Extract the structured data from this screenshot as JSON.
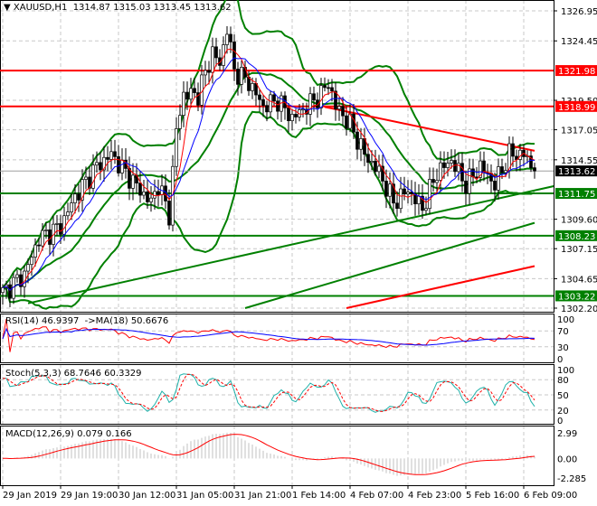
{
  "chart_data": {
    "type": "candlestick",
    "symbol_header": "XAUUSD,H1",
    "ohlc_header": "1314.87 1315.03 1313.45 1313.62",
    "price_axis": {
      "range": [
        1302.2,
        1326.95
      ],
      "ticks": [
        "1326.95",
        "1324.45",
        "1319.50",
        "1317.05",
        "1314.55",
        "1309.60",
        "1307.15",
        "1304.65",
        "1302.20"
      ]
    },
    "current_price": {
      "value": 1313.62,
      "label": "1313.62",
      "color": "#000000"
    },
    "horizontal_levels": [
      {
        "value": 1321.98,
        "label": "1321.98",
        "color": "#ff0000"
      },
      {
        "value": 1318.99,
        "label": "1318.99",
        "color": "#ff0000"
      },
      {
        "value": 1311.75,
        "label": "1311.75",
        "color": "#008000"
      },
      {
        "value": 1308.23,
        "label": "1308.23",
        "color": "#008000"
      },
      {
        "value": 1303.22,
        "label": "1303.22",
        "color": "#008000"
      }
    ],
    "trendlines": [
      {
        "from": [
          89,
          1318.95
        ],
        "to": [
          147,
          1315.3
        ],
        "color": "#ff0000"
      },
      {
        "from": [
          7,
          1302.6
        ],
        "to": [
          153,
          1312.4
        ],
        "color": "#008000"
      },
      {
        "from": [
          67,
          1302.2
        ],
        "to": [
          147,
          1309.3
        ],
        "color": "#008000"
      },
      {
        "from": [
          95,
          1302.2
        ],
        "to": [
          147,
          1305.7
        ],
        "color": "#ff0000"
      }
    ],
    "close_keypoints": [
      [
        0,
        1303.5
      ],
      [
        6,
        1305
      ],
      [
        10,
        1308
      ],
      [
        16,
        1309
      ],
      [
        20,
        1311.5
      ],
      [
        26,
        1314
      ],
      [
        30,
        1315
      ],
      [
        34,
        1313.5
      ],
      [
        38,
        1312
      ],
      [
        41,
        1311
      ],
      [
        43,
        1312.5
      ],
      [
        46,
        1310
      ],
      [
        48,
        1317
      ],
      [
        50,
        1320
      ],
      [
        54,
        1320
      ],
      [
        58,
        1323.5
      ],
      [
        60,
        1322.5
      ],
      [
        62,
        1325.5
      ],
      [
        64,
        1322
      ],
      [
        68,
        1321
      ],
      [
        72,
        1319
      ],
      [
        76,
        1319.5
      ],
      [
        80,
        1318
      ],
      [
        84,
        1319
      ],
      [
        88,
        1320
      ],
      [
        90,
        1321
      ],
      [
        92,
        1319
      ],
      [
        96,
        1317.5
      ],
      [
        100,
        1315
      ],
      [
        104,
        1313.5
      ],
      [
        108,
        1311
      ],
      [
        112,
        1312
      ],
      [
        116,
        1310.5
      ],
      [
        120,
        1313.5
      ],
      [
        124,
        1314.5
      ],
      [
        128,
        1312.5
      ],
      [
        132,
        1314
      ],
      [
        136,
        1312.5
      ],
      [
        140,
        1315
      ],
      [
        144,
        1315
      ],
      [
        147,
        1313.62
      ]
    ],
    "time_axis": [
      "29 Jan 2019",
      "29 Jan 19:00",
      "30 Jan 12:00",
      "31 Jan 05:00",
      "31 Jan 21:00",
      "1 Feb 14:00",
      "4 Feb 07:00",
      "4 Feb 23:00",
      "5 Feb 16:00",
      "6 Feb 09:00"
    ],
    "colors": {
      "bollinger": "#008000",
      "ma_fast": "#ff0000",
      "ma_slow": "#0000ff",
      "grid": "#c0c0c0"
    },
    "grid": true,
    "indicators": {
      "rsi": {
        "header": "RSI(14) 46.9397  ->MA(18) 50.6676",
        "ticks": [
          "100",
          "70",
          "30",
          "0"
        ],
        "colors": {
          "rsi": "#ff0000",
          "ma": "#0000ff"
        }
      },
      "stoch": {
        "header": "Stoch(5,3,3) 68.7646 60.3329",
        "ticks": [
          "100",
          "80",
          "50",
          "20",
          "0"
        ],
        "colors": {
          "main": "#20b2aa",
          "signal": "#ff0000"
        }
      },
      "macd": {
        "header": "MACD(12,26,9) 0.079 0.166",
        "ticks": [
          "2.99",
          "0.00",
          "-2.285"
        ],
        "range": [
          -2.285,
          2.99
        ],
        "colors": {
          "histogram": "#c0c0c0",
          "signal": "#ff0000"
        }
      }
    }
  }
}
